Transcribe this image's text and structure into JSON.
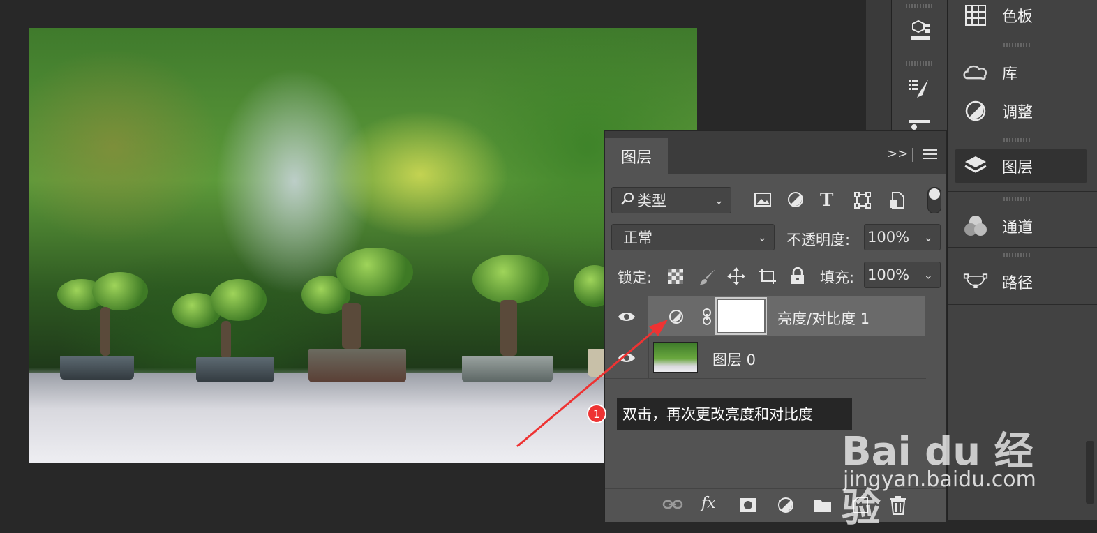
{
  "right_panel": {
    "items": [
      {
        "label": "色板",
        "icon": "swatches-icon"
      },
      {
        "label": "库",
        "icon": "libraries-icon"
      },
      {
        "label": "调整",
        "icon": "adjustments-icon"
      },
      {
        "label": "图层",
        "icon": "layers-icon"
      },
      {
        "label": "通道",
        "icon": "channels-icon"
      },
      {
        "label": "路径",
        "icon": "paths-icon"
      }
    ]
  },
  "layers_panel": {
    "tab_label": "图层",
    "filter": {
      "label": "类型"
    },
    "blend_mode": "正常",
    "opacity_label": "不透明度:",
    "opacity_value": "100%",
    "lock_label": "锁定:",
    "fill_label": "填充:",
    "fill_value": "100%",
    "layers": [
      {
        "name": "亮度/对比度 1",
        "type": "adjustment"
      },
      {
        "name": "图层 0",
        "type": "image"
      }
    ]
  },
  "annotation": {
    "badge": "1",
    "text": "双击，再次更改亮度和对比度"
  },
  "watermark": {
    "logo": "Bai du 经验",
    "url": "jingyan.baidu.com"
  },
  "colors": {
    "accent": "#ee3333",
    "panel": "#535353",
    "header": "#3c3c3c"
  }
}
